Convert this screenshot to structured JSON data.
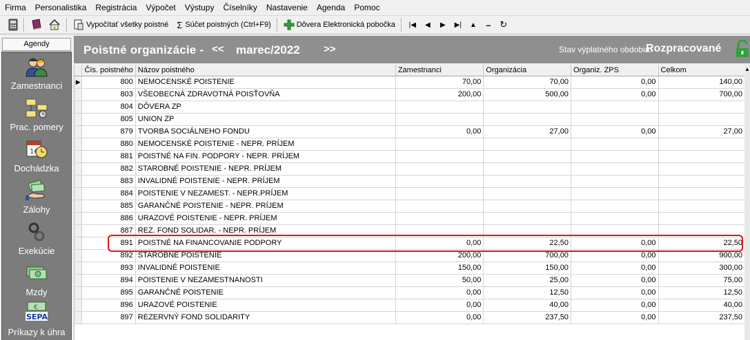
{
  "menu": [
    "Firma",
    "Personalistika",
    "Registrácia",
    "Výpočet",
    "Výstupy",
    "Číselníky",
    "Nastavenie",
    "Agenda",
    "Pomoc"
  ],
  "toolbar": {
    "calc_all": "Vypočítať všetky poistné",
    "sum": "Súčet poistných (Ctrl+F9)",
    "branch": "Dôvera Elektronická pobočka"
  },
  "sidebar": {
    "title": "Agendy",
    "items": [
      {
        "label": "Zamestnanci",
        "icon": "people-icon"
      },
      {
        "label": "Prac. pomery",
        "icon": "org-chart-icon"
      },
      {
        "label": "Dochádzka",
        "icon": "calendar-clock-icon"
      },
      {
        "label": "Zálohy",
        "icon": "money-hand-icon"
      },
      {
        "label": "Exekúcie",
        "icon": "handcuffs-icon"
      },
      {
        "label": "Mzdy",
        "icon": "banknotes-icon"
      },
      {
        "label": "Príkazy k úhra",
        "icon": "sepa-icon"
      }
    ],
    "sepa_text": "SEPA"
  },
  "header": {
    "title": "Poistné organizácie -",
    "prev": "<<",
    "period": "marec/2022",
    "next": ">>",
    "state_label": "Stav výplatného obdobia:",
    "state_value": "Rozpracované"
  },
  "grid": {
    "columns": [
      "Čís. poistného",
      "Názov poistného",
      "Zamestnanci",
      "Organizácia",
      "Organiz. ZPS",
      "Celkom"
    ],
    "rows": [
      {
        "id": "800",
        "name": "NEMOCENSKÉ POISTENIE",
        "zam": "70,00",
        "org": "70,00",
        "zps": "0,00",
        "total": "140,00"
      },
      {
        "id": "803",
        "name": "VŠEOBECNÁ ZDRAVOTNÁ POISŤOVŇA",
        "zam": "200,00",
        "org": "500,00",
        "zps": "0,00",
        "total": "700,00"
      },
      {
        "id": "804",
        "name": "DÔVERA ZP",
        "zam": "",
        "org": "",
        "zps": "",
        "total": ""
      },
      {
        "id": "805",
        "name": "UNION ZP",
        "zam": "",
        "org": "",
        "zps": "",
        "total": ""
      },
      {
        "id": "879",
        "name": "TVORBA SOCIÁLNEHO FONDU",
        "zam": "0,00",
        "org": "27,00",
        "zps": "0,00",
        "total": "27,00"
      },
      {
        "id": "880",
        "name": "NEMOCENSKÉ POISTENIE - NEPR. PRÍJEM",
        "zam": "",
        "org": "",
        "zps": "",
        "total": ""
      },
      {
        "id": "881",
        "name": "POISTNÉ NA FIN. PODPORY - NEPR. PRÍJEM",
        "zam": "",
        "org": "",
        "zps": "",
        "total": ""
      },
      {
        "id": "882",
        "name": "STAROBNÉ POISTENIE - NEPR. PRÍJEM",
        "zam": "",
        "org": "",
        "zps": "",
        "total": ""
      },
      {
        "id": "883",
        "name": "INVALIDNÉ POISTENIE - NEPR. PRÍJEM",
        "zam": "",
        "org": "",
        "zps": "",
        "total": ""
      },
      {
        "id": "884",
        "name": "POISTENIE V NEZAMEST. - NEPR.PRÍJEM",
        "zam": "",
        "org": "",
        "zps": "",
        "total": ""
      },
      {
        "id": "885",
        "name": "GARANČNÉ POISTENIE - NEPR. PRÍJEM",
        "zam": "",
        "org": "",
        "zps": "",
        "total": ""
      },
      {
        "id": "886",
        "name": "URAZOVÉ POISTENIE - NEPR. PRÍJEM",
        "zam": "",
        "org": "",
        "zps": "",
        "total": ""
      },
      {
        "id": "887",
        "name": "REZ. FOND SOLIDAR. - NEPR. PRÍJEM",
        "zam": "",
        "org": "",
        "zps": "",
        "total": ""
      },
      {
        "id": "891",
        "name": "POISTNÉ NA FINANCOVANIE PODPORY",
        "zam": "0,00",
        "org": "22,50",
        "zps": "0,00",
        "total": "22,50"
      },
      {
        "id": "892",
        "name": "STAROBNÉ POISTENIE",
        "zam": "200,00",
        "org": "700,00",
        "zps": "0,00",
        "total": "900,00"
      },
      {
        "id": "893",
        "name": "INVALIDNÉ POISTENIE",
        "zam": "150,00",
        "org": "150,00",
        "zps": "0,00",
        "total": "300,00"
      },
      {
        "id": "894",
        "name": "POISTENIE V NEZAMESTNANOSTI",
        "zam": "50,00",
        "org": "25,00",
        "zps": "0,00",
        "total": "75,00"
      },
      {
        "id": "895",
        "name": "GARANČNÉ POISTENIE",
        "zam": "0,00",
        "org": "12,50",
        "zps": "0,00",
        "total": "12,50"
      },
      {
        "id": "896",
        "name": "URAZOVÉ POISTENIE",
        "zam": "0,00",
        "org": "40,00",
        "zps": "0,00",
        "total": "40,00"
      },
      {
        "id": "897",
        "name": "REZERVNÝ FOND SOLIDARITY",
        "zam": "0,00",
        "org": "237,50",
        "zps": "0,00",
        "total": "237,50"
      }
    ],
    "current_row_index": 0,
    "highlighted_row_index": 13
  },
  "colors": {
    "header_bg": "#8f8f8f",
    "highlight": "#e1141c",
    "lock": "#2fa33a"
  }
}
